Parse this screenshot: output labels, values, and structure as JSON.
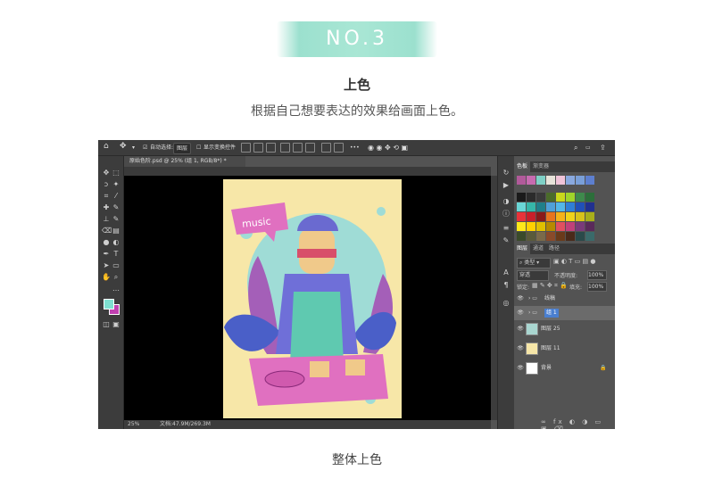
{
  "header": {
    "badge": "NO.3",
    "title": "上色",
    "description": "根据自己想要表达的效果给画面上色。"
  },
  "caption": "整体上色",
  "photoshop": {
    "options_bar": {
      "auto_select_label": "自动选择:",
      "auto_select_value": "图层",
      "show_transform_label": "显示变换控件"
    },
    "document_tab": "原始色阶.psd @ 25% (组 1, RGB/8*) *",
    "status": {
      "zoom": "25%",
      "doc_size": "文档:47.9M/269.3M"
    },
    "swatches_panel": {
      "tabs": [
        "色板",
        "渐变器"
      ],
      "colors": [
        "#b15a9a",
        "#c76bb0",
        "#7fd0c6",
        "#e7e3d9",
        "#f0c4d8",
        "#8aa9df",
        "#7a9fd8",
        "#5d7fcf",
        "#1a1a1a",
        "#2b2b2b",
        "#3a3a3a",
        "#4a6b2a",
        "#c9d81c",
        "#9fd42a",
        "#3e8a4c",
        "#2c6e3a",
        "#6ad6d6",
        "#36b6a8",
        "#1f7f8a",
        "#4fa0d8",
        "#53b7e8",
        "#2f7fd6",
        "#2050b8",
        "#203090",
        "#e8333a",
        "#c91f2a",
        "#8a1a1a",
        "#e8741f",
        "#f5b21a",
        "#f0d21a",
        "#d8c21a",
        "#a8ae1a",
        "#ffe81a",
        "#ffd100",
        "#e0c000",
        "#b68a00",
        "#e05060",
        "#c0407a",
        "#7a3a7a",
        "#5a2a5a",
        "#3a4a2a",
        "#5a5a3a",
        "#7a6a4a",
        "#8a4a2a",
        "#6a3a1a",
        "#4a2a1a",
        "#2a4a4a",
        "#3a6a6a"
      ]
    },
    "layers_panel": {
      "tabs": [
        "图层",
        "通道",
        "路径"
      ],
      "blend_mode": "穿透",
      "opacity_label": "不透明度:",
      "opacity_value": "100%",
      "lock_label": "锁定:",
      "fill_label": "填充:",
      "fill_value": "100%",
      "layers": [
        {
          "name": "线稿",
          "type": "group"
        },
        {
          "name": "组 1",
          "type": "group",
          "selected": true
        },
        {
          "name": "图层 25",
          "type": "layer",
          "thumb": "#a9d6d0"
        },
        {
          "name": "图层 11",
          "type": "layer",
          "thumb": "#f6e6a8"
        },
        {
          "name": "背景",
          "type": "background",
          "thumb": "#ffffff"
        }
      ]
    },
    "artwork": {
      "balloon_text": "music",
      "colors": {
        "paper": "#f7e7a8",
        "circle": "#9fdcd6",
        "overalls": "#5fc9b0",
        "shirt": "#6f6fd8",
        "leaves": "#4a5fc8",
        "purple_leaves": "#a45fb8",
        "deck": "#e070c0",
        "skin": "#f0c98a",
        "hair": "#6a6ad0"
      }
    },
    "foreground_color": "#7fe0d0",
    "background_color": "#c040b0"
  }
}
